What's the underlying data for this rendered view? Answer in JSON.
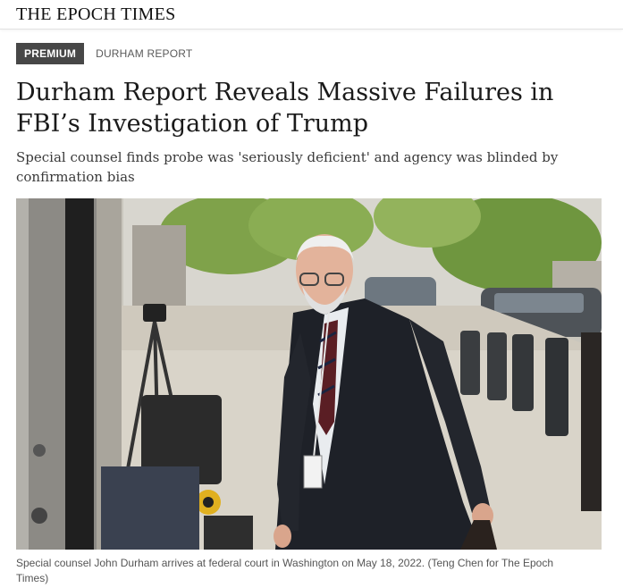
{
  "masthead": {
    "brand": "THE EPOCH TIMES"
  },
  "tags": {
    "premium": "PREMIUM",
    "section": "DURHAM REPORT"
  },
  "article": {
    "headline": "Durham Report Reveals Massive Failures in FBI’s Investigation of Trump",
    "subheadline": "Special counsel finds probe was 'seriously deficient' and agency was blinded by confirmation bias"
  },
  "photo": {
    "caption": "Special counsel John Durham arrives at federal court in Washington on May 18, 2022. (Teng Chen for The Epoch Times)"
  },
  "colors": {
    "premium_badge_bg": "#474747",
    "premium_badge_text": "#ffffff",
    "text": "#1a1a1a",
    "caption_text": "#555555"
  }
}
